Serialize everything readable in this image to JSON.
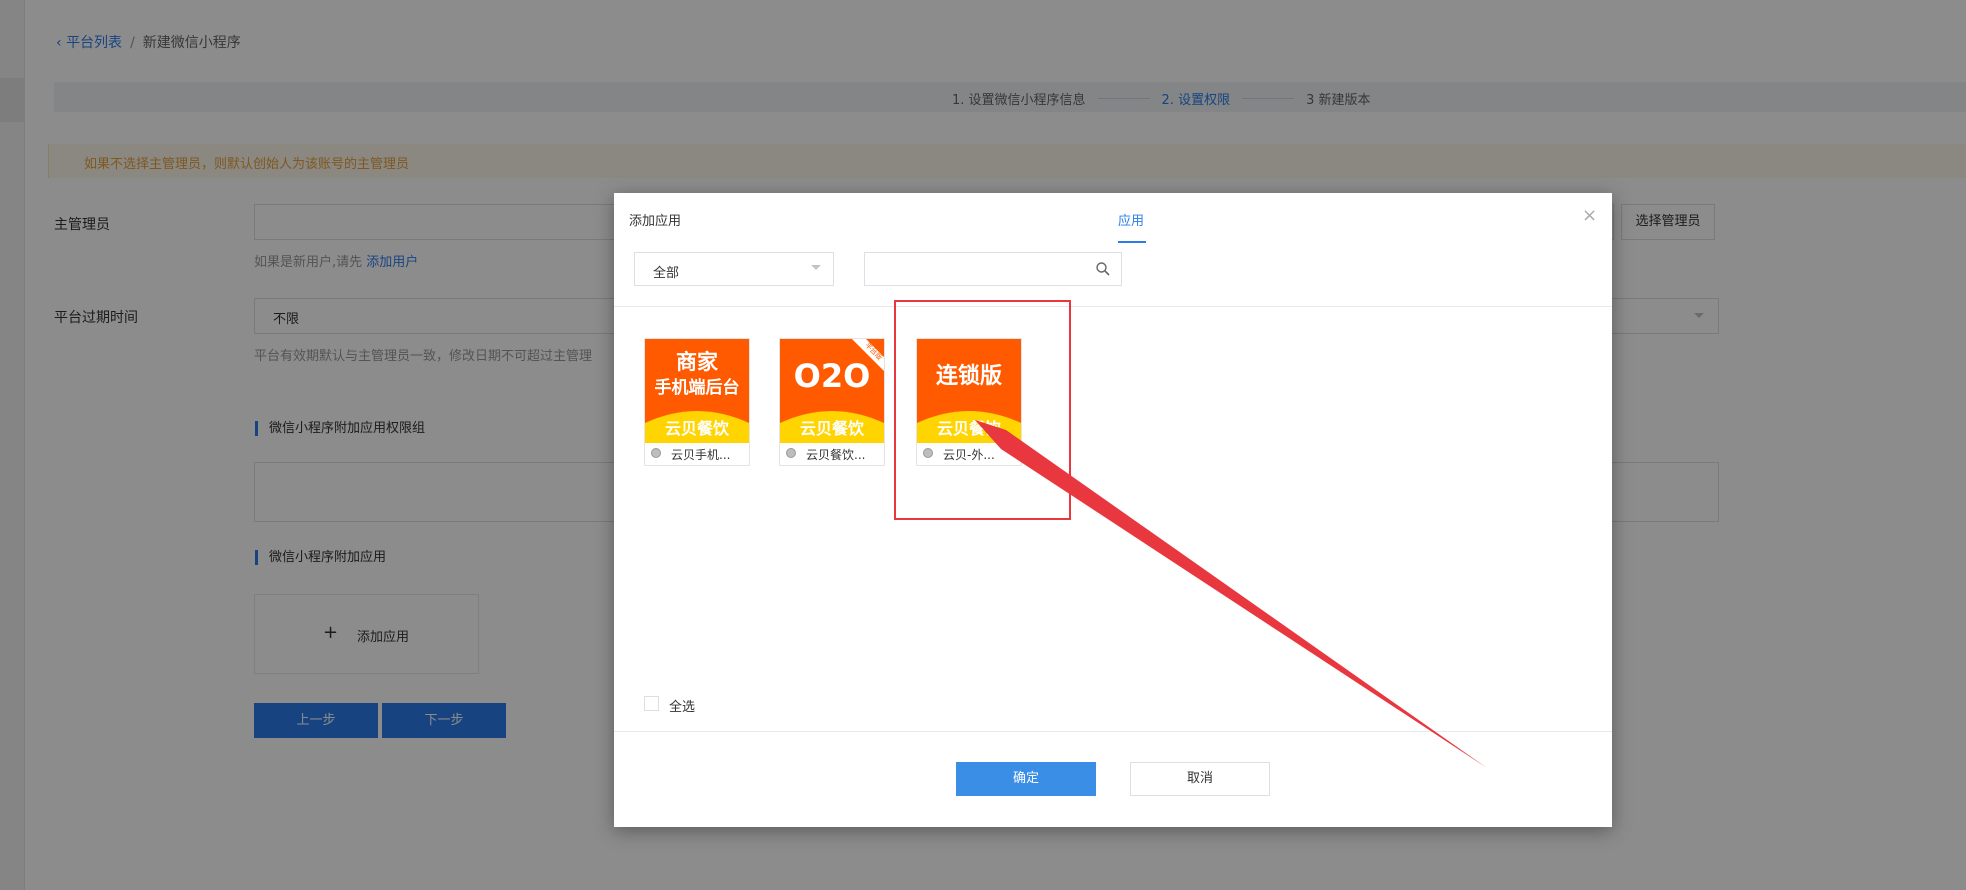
{
  "breadcrumb": {
    "back": "平台列表",
    "sep": "/",
    "current": "新建微信小程序"
  },
  "steps": [
    {
      "label": "1. 设置微信小程序信息"
    },
    {
      "label": "2. 设置权限"
    },
    {
      "label": "3 新建版本"
    }
  ],
  "notice": "如果不选择主管理员，则默认创始人为该账号的主管理员",
  "form": {
    "admin_label": "主管理员",
    "admin_button": "选择管理员",
    "admin_hint_prefix": "如果是新用户,请先",
    "admin_hint_link": "添加用户",
    "expire_label": "平台过期时间",
    "expire_value": "不限",
    "expire_hint": "平台有效期默认与主管理员一致，修改日期不可超过主管理",
    "perm_group_title": "微信小程序附加应用权限组",
    "apps_title": "微信小程序附加应用",
    "add_app_label": "添加应用",
    "prev_button": "上一步",
    "next_button": "下一步"
  },
  "modal": {
    "title": "添加应用",
    "tab": "应用",
    "close": "×",
    "filter_value": "全部",
    "search_value": "",
    "select_all": "全选",
    "ok": "确定",
    "cancel": "取消",
    "apps": [
      {
        "title_line1": "商家",
        "title_line2": "手机端后台",
        "brand": "云贝餐饮",
        "name": "云贝手机...",
        "ribbon": ""
      },
      {
        "title_line1": "O2O",
        "title_line2": "",
        "brand": "云贝餐饮",
        "name": "云贝餐饮...",
        "ribbon": "平台版"
      },
      {
        "title_line1": "连锁版",
        "title_line2": "",
        "brand": "云贝餐饮",
        "name": "云贝-外...",
        "ribbon": ""
      }
    ]
  },
  "colors": {
    "accent": "#2b7de9",
    "warning": "#e6a23c",
    "app_orange": "#ff5a00",
    "app_yellow": "#ffd400",
    "annotation_red": "#e8373e"
  }
}
